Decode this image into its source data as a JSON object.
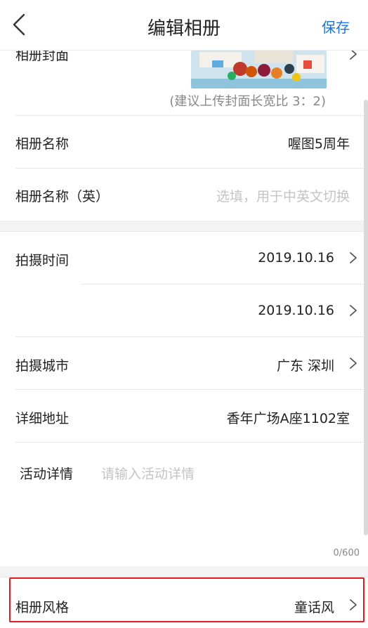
{
  "nav": {
    "title": "编辑相册",
    "save_label": "保存"
  },
  "cover": {
    "label": "相册封面",
    "hint": "(建议上传封面长宽比 3：2)"
  },
  "album_name": {
    "label": "相册名称",
    "value": "喔图5周年"
  },
  "album_name_en": {
    "label": "相册名称（英）",
    "placeholder": "选填，用于中英文切换"
  },
  "shoot_time": {
    "label": "拍摄时间",
    "start": "2019.10.16",
    "end": "2019.10.16"
  },
  "shoot_city": {
    "label": "拍摄城市",
    "value": "广东 深圳"
  },
  "address": {
    "label": "详细地址",
    "value": "香年广场A座1102室"
  },
  "activity": {
    "label": "活动详情",
    "placeholder": "请输入活动详情",
    "counter": "0/600"
  },
  "style": {
    "label": "相册风格",
    "value": "童话风"
  },
  "colors": {
    "accent": "#1a73e8",
    "highlight": "#e02020"
  }
}
